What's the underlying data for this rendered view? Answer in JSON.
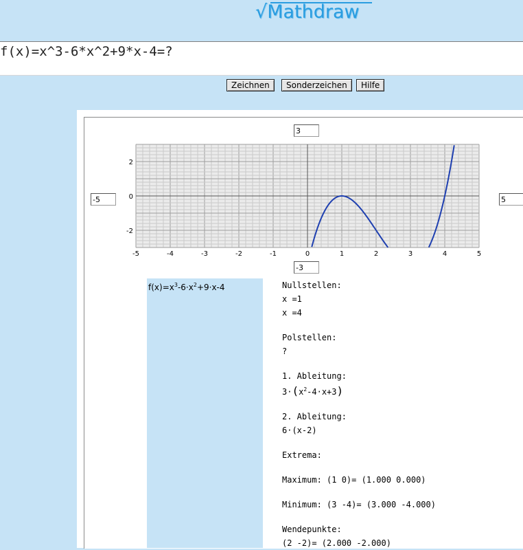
{
  "header": {
    "logo_text": "Mathdraw",
    "logo_symbol": "√"
  },
  "formula": {
    "value": "f(x)=x^3-6*x^2+9*x-4=?"
  },
  "toolbar": {
    "draw_label": "Zeichnen",
    "special_chars_label": "Sonderzeichen",
    "help_label": "Hilfe"
  },
  "plot": {
    "ymax_value": "3",
    "ymin_value": "-3",
    "xmin_value": "-5",
    "xmax_value": "5"
  },
  "chart_data": {
    "type": "line",
    "series": [
      {
        "expr": "x^3-6*x^2+9*x-4",
        "color": "#1e3fb0"
      }
    ],
    "xlim": [
      -5,
      5
    ],
    "ylim": [
      -3,
      3
    ],
    "x_ticks": [
      "-5",
      "-4",
      "-3",
      "-2",
      "-1",
      "0",
      "1",
      "2",
      "3",
      "4",
      "5"
    ],
    "y_ticks": [
      "2",
      "0",
      "-2"
    ],
    "grid": true
  },
  "function_display": {
    "prefix": "f(x)=x",
    "exp1": "3",
    "mid": "-6·x",
    "exp2": "2",
    "suffix": "+9·x-4"
  },
  "analysis": {
    "zeros_heading": "Nullstellen:",
    "zero1": "x =1",
    "zero2": "x =4",
    "poles_heading": "Polstellen:",
    "poles_value": "?",
    "deriv1_heading": "1. Ableitung:",
    "deriv1_pre": "3·",
    "deriv1_x": "x",
    "deriv1_exp": "2",
    "deriv1_rest": "-4·x+3",
    "deriv2_heading": "2. Ableitung:",
    "deriv2_value": "6·(x-2)",
    "extrema_heading": "Extrema:",
    "maximum": "Maximum:  (1  0)= (1.000  0.000)",
    "minimum": "Minimum:  (3  -4)= (3.000  -4.000)",
    "inflection_heading": "Wendepunkte:",
    "inflection_value": " (2  -2)= (2.000  -2.000)"
  }
}
